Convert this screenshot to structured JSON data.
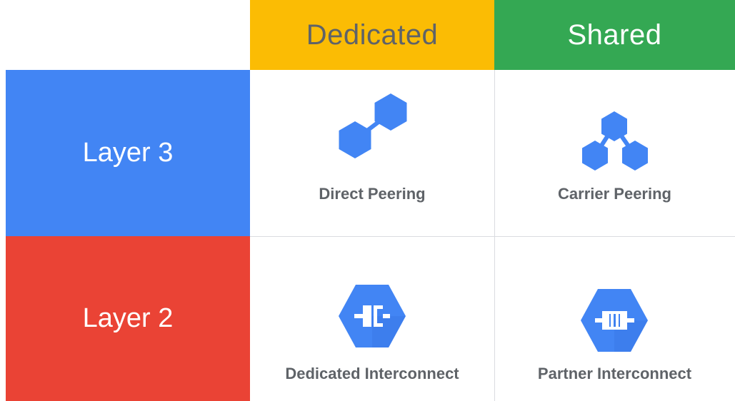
{
  "columns": {
    "dedicated": {
      "label": "Dedicated",
      "color": "#fbbc04",
      "text_color": "#5f6368"
    },
    "shared": {
      "label": "Shared",
      "color": "#34a853",
      "text_color": "#ffffff"
    }
  },
  "rows": {
    "layer3": {
      "label": "Layer 3",
      "color": "#4285f4"
    },
    "layer2": {
      "label": "Layer 2",
      "color": "#ea4335"
    }
  },
  "cells": {
    "direct_peering": {
      "label": "Direct Peering",
      "icon": "direct-peering-icon"
    },
    "carrier_peering": {
      "label": "Carrier Peering",
      "icon": "carrier-peering-icon"
    },
    "dedicated_interconnect": {
      "label": "Dedicated Interconnect",
      "icon": "dedicated-interconnect-icon"
    },
    "partner_interconnect": {
      "label": "Partner Interconnect",
      "icon": "partner-interconnect-icon"
    }
  },
  "icon_color": "#4285f4"
}
